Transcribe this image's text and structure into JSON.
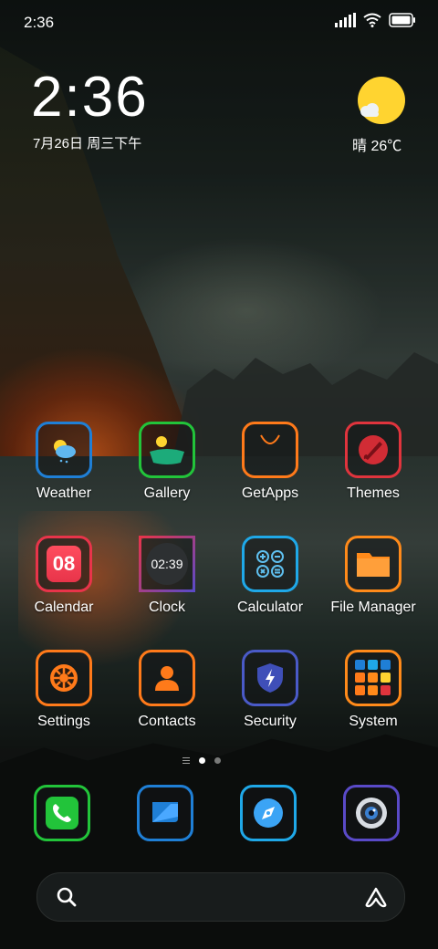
{
  "status_bar": {
    "time": "2:36",
    "icons": [
      "signal-icon",
      "wifi-icon",
      "battery-icon"
    ]
  },
  "clock_widget": {
    "time": "2:36",
    "date": "7月26日 周三下午"
  },
  "weather_widget": {
    "icon": "sun-cloud-icon",
    "text": "晴 26℃"
  },
  "apps": [
    {
      "label": "Weather",
      "icon": "weather-icon",
      "border": "#1f7fd6"
    },
    {
      "label": "Gallery",
      "icon": "gallery-icon",
      "border": "#22c43a"
    },
    {
      "label": "GetApps",
      "icon": "getapps-icon",
      "border": "#ff7a1a"
    },
    {
      "label": "Themes",
      "icon": "themes-icon",
      "border": "#e0343d"
    },
    {
      "label": "Calendar",
      "icon": "calendar-icon",
      "border": "#e8344a",
      "badge": "08"
    },
    {
      "label": "Clock",
      "icon": "clock-icon",
      "border": "#c44da0",
      "badge": "02:39"
    },
    {
      "label": "Calculator",
      "icon": "calculator-icon",
      "border": "#1fa8e8"
    },
    {
      "label": "File Manager",
      "icon": "folder-icon",
      "border": "#ff8a1a"
    },
    {
      "label": "Settings",
      "icon": "gear-icon",
      "border": "#ff7a1a"
    },
    {
      "label": "Contacts",
      "icon": "contacts-icon",
      "border": "#ff7a1a"
    },
    {
      "label": "Security",
      "icon": "shield-icon",
      "border": "#4a5ac8"
    },
    {
      "label": "System",
      "icon": "folder-grid-icon",
      "border": "#ff8a1a"
    }
  ],
  "page_indicator": {
    "pages": 2,
    "current": 1
  },
  "dock": [
    {
      "icon": "phone-icon",
      "border": "#22c43a"
    },
    {
      "icon": "messages-icon",
      "border": "#1f7fd6"
    },
    {
      "icon": "browser-icon",
      "border": "#1fa8e8"
    },
    {
      "icon": "camera-icon",
      "border": "#5a4ac8"
    }
  ],
  "search_bar": {
    "left_icon": "search-icon",
    "right_icon": "assistant-icon"
  }
}
